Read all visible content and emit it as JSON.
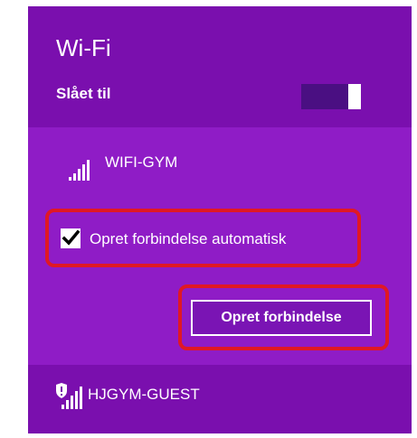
{
  "wifi": {
    "title": "Wi-Fi",
    "state_label": "Slået til",
    "toggle_on": true
  },
  "networks": [
    {
      "name": "WIFI-GYM",
      "icon": "wifi-signal-icon",
      "secured": false,
      "expanded": true,
      "connect_automatically_label": "Opret forbindelse automatisk",
      "connect_automatically_checked": true,
      "connect_button_label": "Opret forbindelse"
    },
    {
      "name": "HJGYM-GUEST",
      "icon": "wifi-signal-shield-icon",
      "secured": true,
      "expanded": false
    }
  ],
  "colors": {
    "panel_dark": "#7a0fae",
    "panel_selected": "#8f1cc6",
    "highlight_red": "#e01824",
    "text": "#ffffff"
  }
}
